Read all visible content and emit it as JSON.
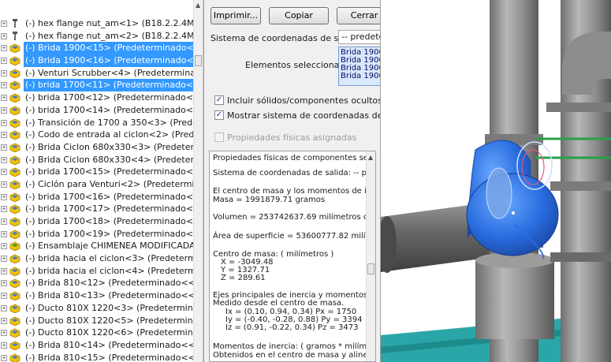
{
  "tree": {
    "items": [
      {
        "label": "(-) hex flange nut_am<1> (B18.2.2.4M - ",
        "icon": "hardware-icon",
        "selected": false
      },
      {
        "label": "(-) hex flange nut_am<2> (B18.2.2.4M - ",
        "icon": "hardware-icon",
        "selected": false
      },
      {
        "label": "(-) Brida 1900<15> (Predeterminado<<F",
        "icon": "part-icon",
        "selected": true
      },
      {
        "label": "(-) Brida 1900<16> (Predeterminado<<F",
        "icon": "part-icon",
        "selected": true
      },
      {
        "label": "(-) Venturi Scrubber<4> (Predeterminad",
        "icon": "part-icon",
        "selected": false
      },
      {
        "label": "(-) brida 1700<11> (Predeterminado<<F",
        "icon": "part-icon",
        "selected": true
      },
      {
        "label": "(-) brida 1700<12> (Predeterminado<<F",
        "icon": "part-icon",
        "selected": false
      },
      {
        "label": "(-) brida 1700<14> (Predeterminado<<F",
        "icon": "part-icon",
        "selected": false
      },
      {
        "label": "(-) Transición de 1700 a 350<3> (Predete",
        "icon": "part-icon",
        "selected": false
      },
      {
        "label": "(-) Codo de entrada al ciclon<2> (Predet",
        "icon": "part-icon",
        "selected": false
      },
      {
        "label": "(-) Brida Ciclon 680x330<3> (Predetermi",
        "icon": "part-icon",
        "selected": false
      },
      {
        "label": "(-) Brida Ciclon 680x330<4> (Predetermi",
        "icon": "part-icon",
        "selected": false
      },
      {
        "label": "(-) brida 1700<15> (Predeterminado<<F",
        "icon": "part-icon",
        "selected": false
      },
      {
        "label": "(-) Ciclón para Venturi<2> (Predetermin",
        "icon": "part-icon",
        "selected": false
      },
      {
        "label": "(-) brida 1700<16> (Predeterminado<<F",
        "icon": "part-icon",
        "selected": false
      },
      {
        "label": "(-) brida 1700<17> (Predeterminado<<F",
        "icon": "part-icon",
        "selected": false
      },
      {
        "label": "(-) brida 1700<18> (Predeterminado<<F",
        "icon": "part-icon",
        "selected": false
      },
      {
        "label": "(-) brida 1700<19> (Predeterminado<<F",
        "icon": "part-icon",
        "selected": false
      },
      {
        "label": "(-) Ensamblaje CHIMENEA MODIFICADA",
        "icon": "assembly-icon",
        "selected": false
      },
      {
        "label": "(-) brida hacia el ciclon<3> (Predetermir",
        "icon": "part-icon",
        "selected": false
      },
      {
        "label": "(-) brida hacia el ciclon<4> (Predetermir",
        "icon": "part-icon",
        "selected": false
      },
      {
        "label": "(-) Brida 810<12> (Predeterminado<<Pr",
        "icon": "part-icon",
        "selected": false
      },
      {
        "label": "(-) Brida 810<13> (Predeterminado<<Pr",
        "icon": "part-icon",
        "selected": false
      },
      {
        "label": "(-) Ducto 810X 1220<3> (Predeterminad",
        "icon": "part-icon",
        "selected": false
      },
      {
        "label": "(-) Ducto 810X 1220<5> (Predeterminad",
        "icon": "part-icon",
        "selected": false
      },
      {
        "label": "(-) Ducto 810X 1220<6> (Predeterminad",
        "icon": "part-icon",
        "selected": false
      },
      {
        "label": "(-) Brida 810<14> (Predeterminado<<Pr",
        "icon": "part-icon",
        "selected": false
      },
      {
        "label": "(-) Brida 810<15> (Predeterminado<<Pr",
        "icon": "part-icon",
        "selected": false
      }
    ]
  },
  "dialog": {
    "buttons": {
      "print": "Imprimir...",
      "copy": "Copiar",
      "close": "Cerrar"
    },
    "output_coord_label": "Sistema de coordenadas de salida:",
    "output_coord_value": "-- predeter",
    "selected_label": "Elementos seleccionados:",
    "selected_items": [
      "Brida 1900",
      "Brida 1900",
      "Brida 1900",
      "Brida 1900"
    ],
    "include_hidden": {
      "label": "Incluir sólidos/componentes ocultos",
      "checked": true
    },
    "show_coord": {
      "label": "Mostrar sistema de coordenadas de salida e",
      "checked": true
    },
    "assigned_props": {
      "label": "Propiedades físicas asignadas",
      "checked": false
    },
    "results": [
      "Propiedades físicas de componentes selecc",
      "Sistema de coordenadas de salida: -- prede",
      "El centro de masa y los momentos de inerci",
      "Masa = 1991879.71 gramos",
      "Volumen = 253742637.69  milímetros cúbicc",
      "Área de superficie = 53600777.82  milímetr",
      "Centro de masa: ( milímetros )",
      "X = -3049.48",
      "Y = 1327.71",
      "Z = 289.61",
      "Ejes principales de inercia y momentos princ",
      "Medido desde el centro de masa.",
      "Ix = (0.10, 0.94, 0.34)      Px = 1750",
      "Iy = (-0.40, -0.28, 0.88)   Py = 3394",
      "Iz = (0.91, -0.22, 0.34)    Pz = 3473",
      "Momentos de inercia: ( gramos * milímetro:",
      "Obtenidos en el centro de masa y alineado:"
    ]
  },
  "colors": {
    "selection": "#3399ff",
    "highlight_blue": "#2f6fe0",
    "pipe_gray": "#8a8a8a",
    "floor_teal": "#2aa6a8",
    "frame_green": "#28a048"
  }
}
